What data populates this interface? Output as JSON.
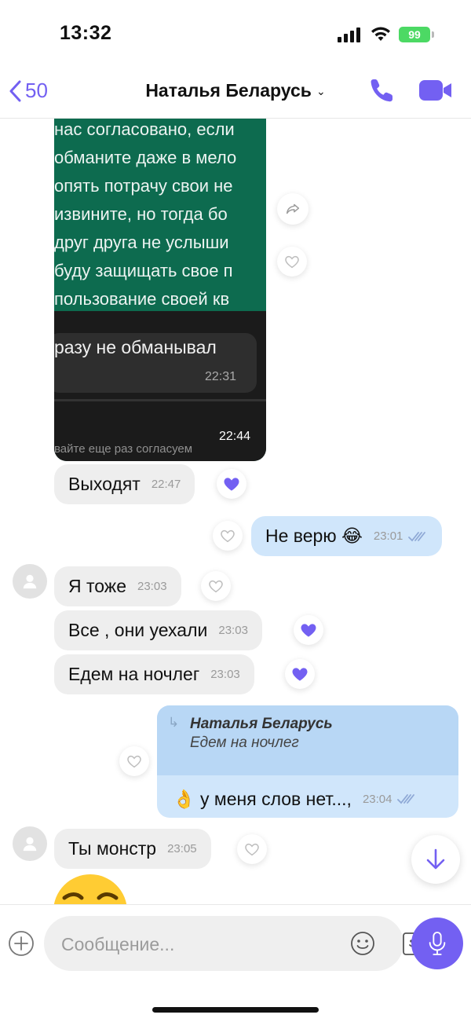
{
  "status_bar": {
    "time": "13:32",
    "battery": "99"
  },
  "header": {
    "back_count": "50",
    "title": "Наталья Беларусь"
  },
  "photo": {
    "lines": [
      "нас согласовано, если",
      "обманите даже в мело",
      "опять потрачу свои не",
      "извините, но тогда бо",
      "друг друга не услыши",
      "буду защищать свое п",
      "пользование своей кв"
    ],
    "inner_text": "разу не обманывал",
    "inner_time": "22:31",
    "bottom_text": "вайте еще раз согласуем",
    "time": "22:44"
  },
  "messages": [
    {
      "text": "Выходят",
      "time": "22:47"
    },
    {
      "text": "Не верю 😂",
      "time": "23:01"
    },
    {
      "text": "Я тоже",
      "time": "23:03"
    },
    {
      "text": "Все , они уехали",
      "time": "23:03"
    },
    {
      "text": "Едем на ночлег",
      "time": "23:03"
    },
    {
      "reply_name": "Наталья Беларусь",
      "reply_quote": "Едем на ночлег",
      "text": "👌 у меня слов нет...,",
      "time": "23:04"
    },
    {
      "text": "Ты монстр",
      "time": "23:05"
    }
  ],
  "composer": {
    "placeholder": "Сообщение..."
  },
  "colors": {
    "accent": "#7360f2",
    "incoming": "#eeeeee",
    "outgoing": "#d0e6fb"
  }
}
